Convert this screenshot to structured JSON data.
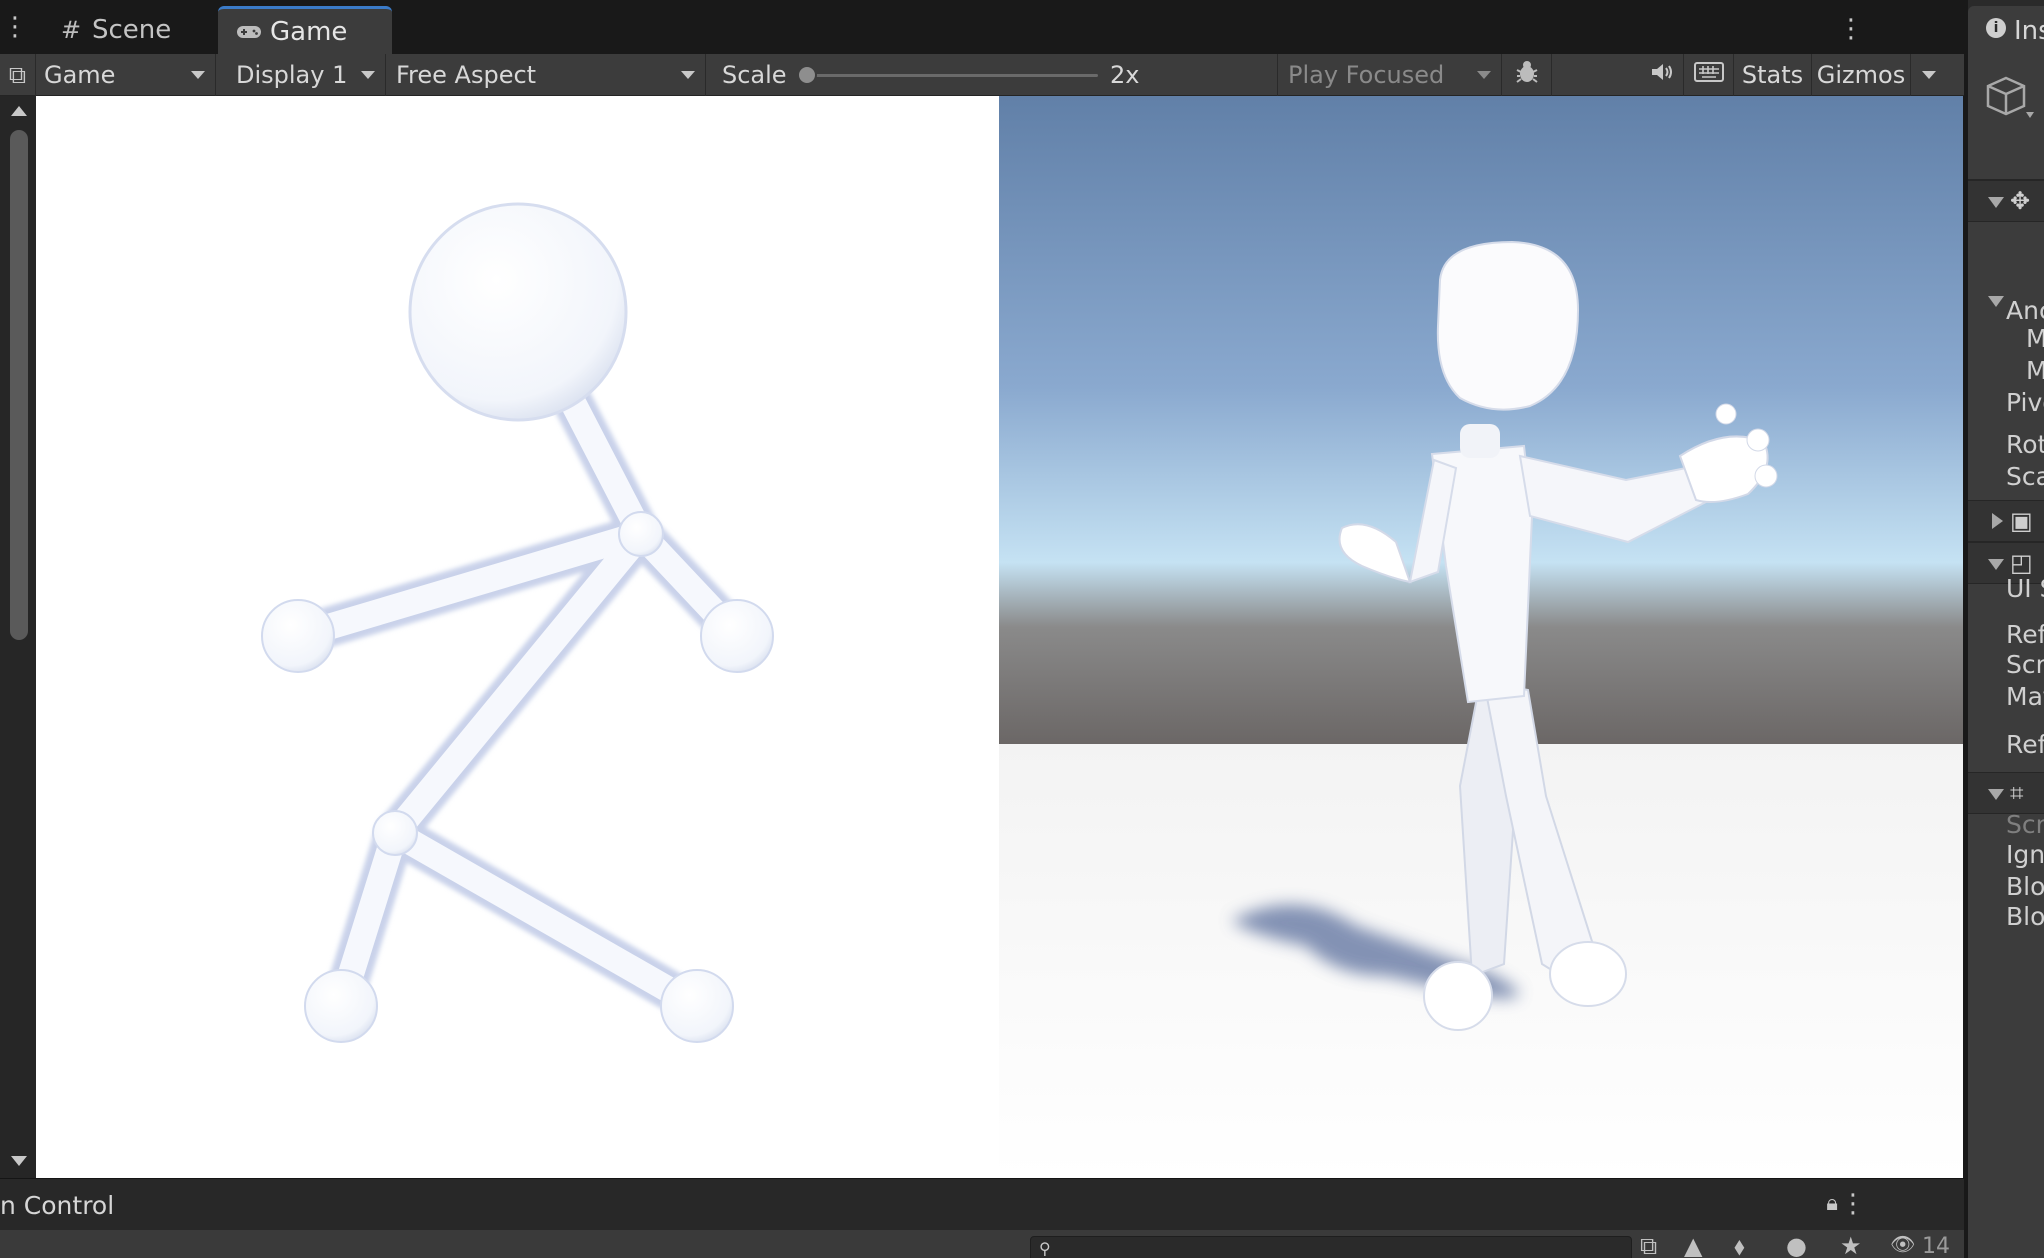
{
  "tabs": {
    "scene_label": "Scene",
    "game_label": "Game",
    "scene_icon": "grid-hash-icon",
    "game_icon": "gamepad-icon"
  },
  "toolbar": {
    "game_dropdown": "Game",
    "display_dropdown": "Display 1",
    "aspect_dropdown": "Free Aspect",
    "scale_label": "Scale",
    "scale_value": "2x",
    "scale_fraction": 0.0,
    "play_mode_dropdown": "Play Focused",
    "stats_label": "Stats",
    "gizmos_label": "Gizmos"
  },
  "bottom_panel": {
    "title": "n Control",
    "search_placeholder": "",
    "hidden_count": "14"
  },
  "inspector": {
    "tab_label": "Ins",
    "labels": [
      "Anc",
      "M",
      "M",
      "Pivo",
      "Rot",
      "Sca",
      "UI S",
      "Refe",
      "Scre",
      "Mat",
      "Refe",
      "Scri",
      "Ignc",
      "Bloc",
      "Bloc"
    ]
  },
  "colors": {
    "accent": "#3b7bc8",
    "panel": "#3c3c3c",
    "background": "#191919",
    "sky_top": "#6a86ac",
    "sky_horizon": "#cfe6f4",
    "ground": "#ffffff"
  }
}
